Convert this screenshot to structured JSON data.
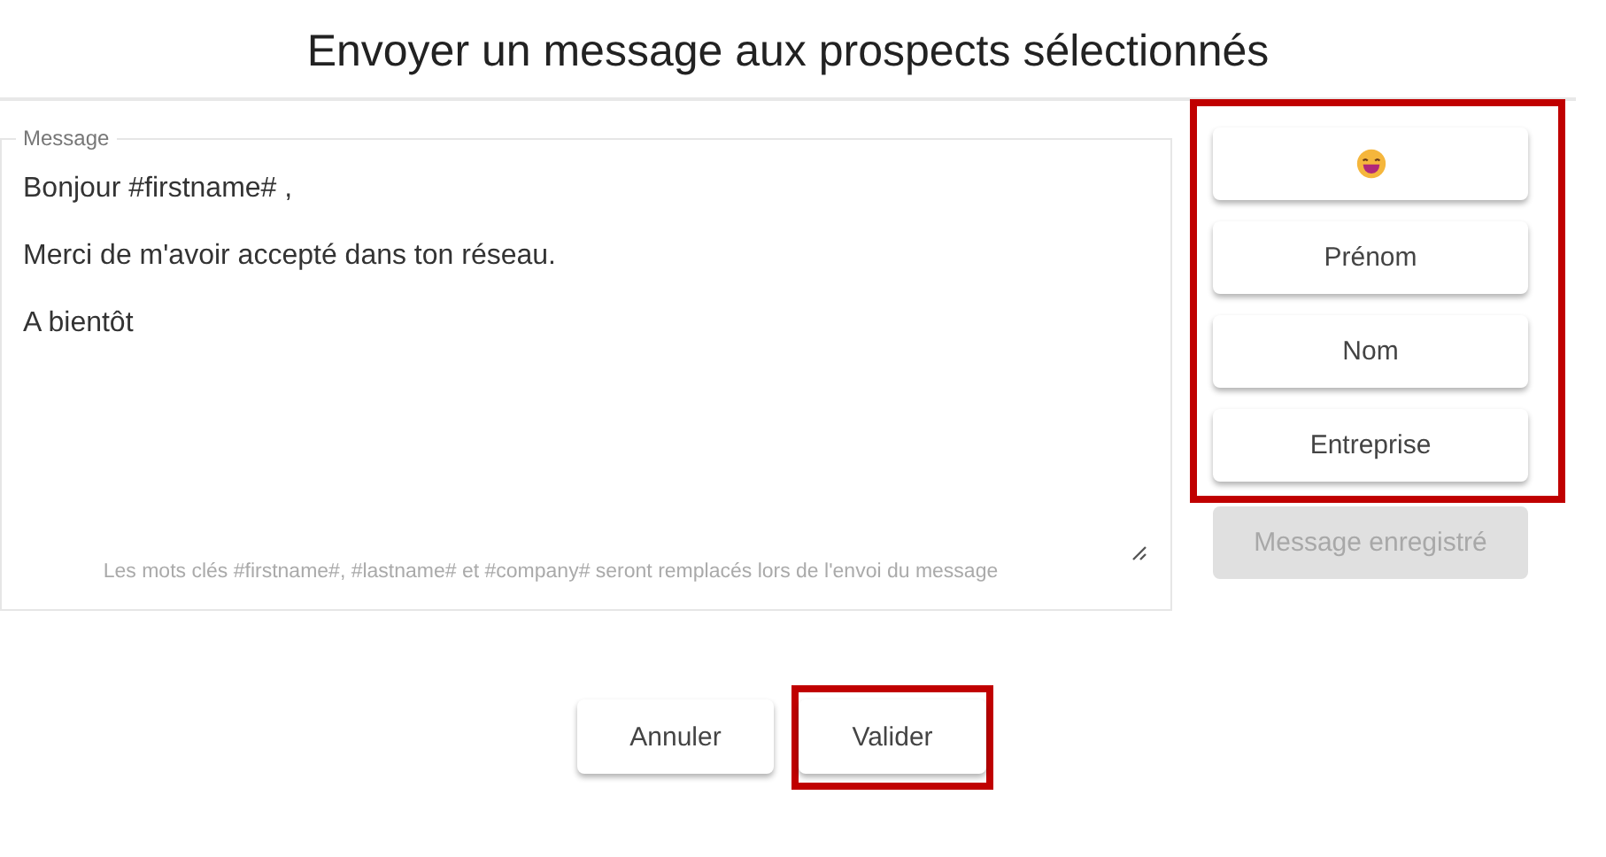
{
  "title": "Envoyer un message aux prospects sélectionnés",
  "message": {
    "label": "Message",
    "lines": [
      "Bonjour #firstname# ,",
      "Merci de m'avoir accepté dans ton réseau.",
      "A bientôt"
    ],
    "hint": "Les mots clés #firstname#, #lastname# et #company# seront remplacés lors de l'envoi du message"
  },
  "insert_buttons": [
    {
      "kind": "emoji"
    },
    {
      "kind": "text",
      "label": "Prénom"
    },
    {
      "kind": "text",
      "label": "Nom"
    },
    {
      "kind": "text",
      "label": "Entreprise"
    }
  ],
  "save_button": {
    "label": "Message enregistré",
    "disabled": true
  },
  "actions": [
    {
      "label": "Annuler",
      "highlighted": false
    },
    {
      "label": "Valider",
      "highlighted": true
    }
  ]
}
